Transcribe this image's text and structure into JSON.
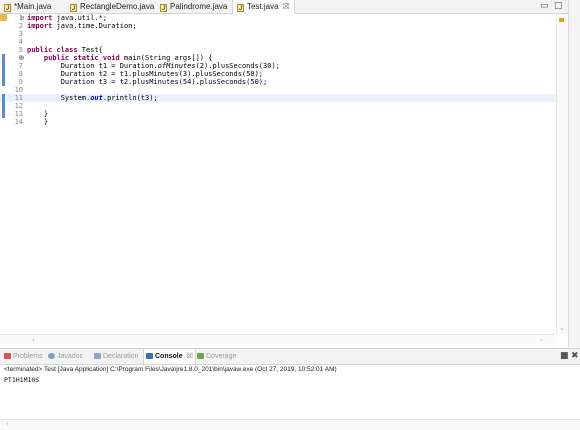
{
  "editor": {
    "tabs": [
      {
        "label": "*Main.java",
        "active": false
      },
      {
        "label": "RectangleDemo.java",
        "active": false
      },
      {
        "label": "Palindrome.java",
        "active": false
      },
      {
        "label": "Test.java",
        "active": true
      }
    ],
    "close_glyph": "☒",
    "lines": [
      {
        "num": "1",
        "fold": "⊖",
        "tokens": [
          {
            "t": "import",
            "k": "kw"
          },
          {
            "t": " java.util.*;"
          }
        ]
      },
      {
        "num": "2",
        "tokens": [
          {
            "t": "import",
            "k": "kw"
          },
          {
            "t": " java.time.Duration;"
          }
        ]
      },
      {
        "num": "3",
        "tokens": []
      },
      {
        "num": "4",
        "tokens": []
      },
      {
        "num": "5",
        "tokens": [
          {
            "t": "public class",
            "k": "kw"
          },
          {
            "t": " Test{"
          }
        ]
      },
      {
        "num": "6",
        "fold": "⊖",
        "tokens": [
          {
            "t": "    "
          },
          {
            "t": "public static void",
            "k": "kw"
          },
          {
            "t": " main(String args[]) {"
          }
        ]
      },
      {
        "num": "7",
        "tokens": [
          {
            "t": "        Duration t1 = Duration."
          },
          {
            "t": "ofMinutes",
            "k": "ital"
          },
          {
            "t": "(2).plusSeconds(30);"
          }
        ]
      },
      {
        "num": "8",
        "tokens": [
          {
            "t": "        Duration t2 = t1.plusMinutes(3).plusSeconds(50);"
          }
        ]
      },
      {
        "num": "9",
        "tokens": [
          {
            "t": "        Duration t3 = t2.plusMinutes(54).plusSeconds(50);"
          }
        ]
      },
      {
        "num": "10",
        "tokens": []
      },
      {
        "num": "11",
        "current": true,
        "tokens": [
          {
            "t": "        System."
          },
          {
            "t": "out",
            "k": "fld"
          },
          {
            "t": ".println(t3);"
          }
        ]
      },
      {
        "num": "12",
        "tokens": []
      },
      {
        "num": "13",
        "tokens": [
          {
            "t": "    }"
          }
        ]
      },
      {
        "num": "14",
        "tokens": [
          {
            "t": "    }"
          }
        ]
      }
    ]
  },
  "bottom_panel": {
    "tabs": [
      {
        "label": "Problems",
        "active": false,
        "icon_color": "#d9534f"
      },
      {
        "label": "Javadoc",
        "active": false,
        "icon_color": "#7a9cc6"
      },
      {
        "label": "Declaration",
        "active": false,
        "icon_color": "#8aa6c8"
      },
      {
        "label": "Console",
        "active": true,
        "icon_color": "#3b6fb6"
      },
      {
        "label": "Coverage",
        "active": false,
        "icon_color": "#6aa84f"
      }
    ],
    "console_status": "<terminated> Test [Java Application] C:\\Program Files\\Java\\jre1.8.0_201\\bin\\javaw.exe (Oct 27, 2019, 10:52:01 AM)",
    "console_output": "PT1H1M10S"
  }
}
